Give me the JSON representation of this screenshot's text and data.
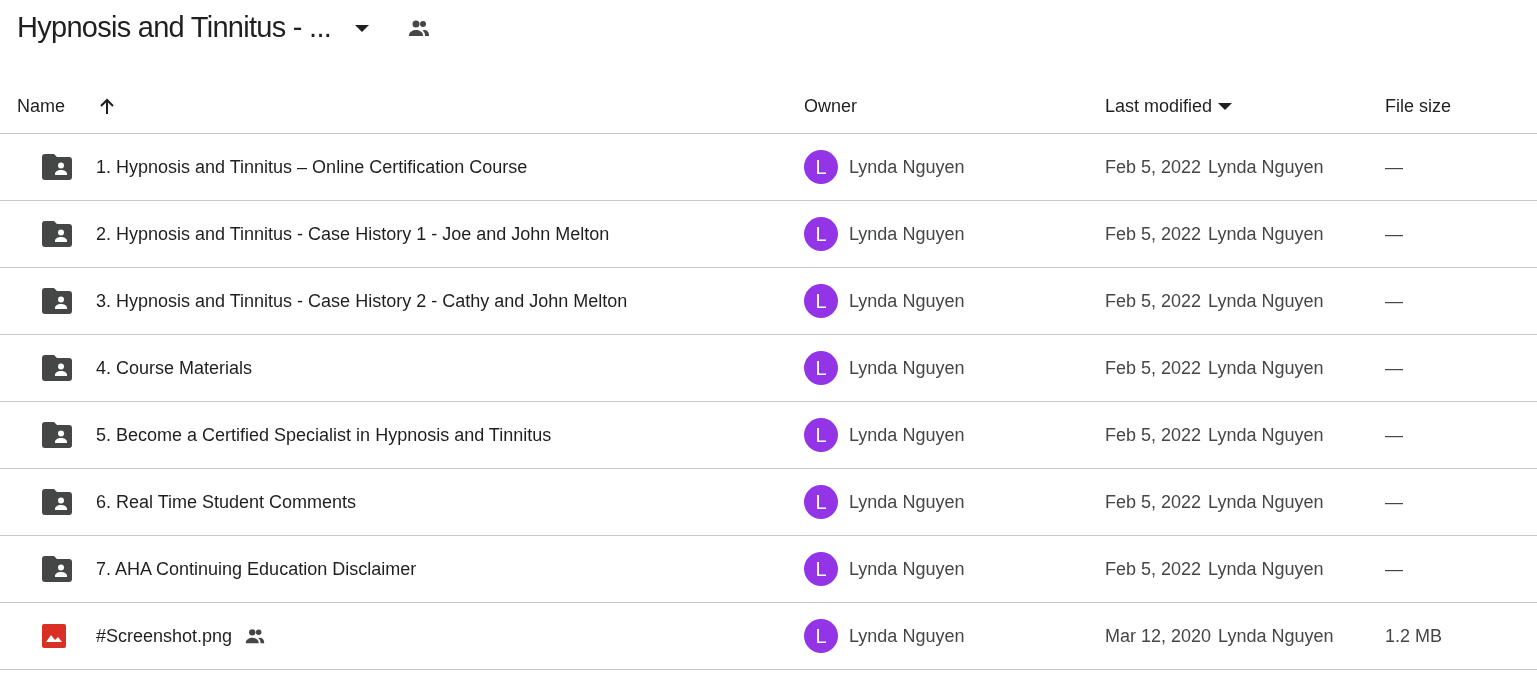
{
  "folder_title": "Hypnosis and Tinnitus - ...",
  "columns": [
    {
      "label": "Name",
      "kind": "sorted-ascending"
    },
    {
      "label": "Owner",
      "kind": "plain"
    },
    {
      "label": "Last modified",
      "kind": "sorted-descending"
    },
    {
      "label": "File size",
      "kind": "plain"
    }
  ],
  "rows": [
    {
      "kind": "shared-folder",
      "name": "1. Hypnosis and Tinnitus – Online Certification Course",
      "shared": false,
      "owner_initial": "L",
      "owner": "Lynda Nguyen",
      "modified_date": "Feb 5, 2022",
      "modified_by": "Lynda Nguyen",
      "size": "—"
    },
    {
      "kind": "shared-folder",
      "name": "2. Hypnosis and Tinnitus - Case History 1 - Joe and John Melton",
      "shared": false,
      "owner_initial": "L",
      "owner": "Lynda Nguyen",
      "modified_date": "Feb 5, 2022",
      "modified_by": "Lynda Nguyen",
      "size": "—"
    },
    {
      "kind": "shared-folder",
      "name": "3. Hypnosis and Tinnitus - Case History 2 - Cathy and John Melton",
      "shared": false,
      "owner_initial": "L",
      "owner": "Lynda Nguyen",
      "modified_date": "Feb 5, 2022",
      "modified_by": "Lynda Nguyen",
      "size": "—"
    },
    {
      "kind": "shared-folder",
      "name": "4. Course Materials",
      "shared": false,
      "owner_initial": "L",
      "owner": "Lynda Nguyen",
      "modified_date": "Feb 5, 2022",
      "modified_by": "Lynda Nguyen",
      "size": "—"
    },
    {
      "kind": "shared-folder",
      "name": "5. Become a Certified Specialist in Hypnosis and Tinnitus",
      "shared": false,
      "owner_initial": "L",
      "owner": "Lynda Nguyen",
      "modified_date": "Feb 5, 2022",
      "modified_by": "Lynda Nguyen",
      "size": "—"
    },
    {
      "kind": "shared-folder",
      "name": "6. Real Time Student Comments",
      "shared": false,
      "owner_initial": "L",
      "owner": "Lynda Nguyen",
      "modified_date": "Feb 5, 2022",
      "modified_by": "Lynda Nguyen",
      "size": "—"
    },
    {
      "kind": "shared-folder",
      "name": "7. AHA Continuing Education Disclaimer",
      "shared": false,
      "owner_initial": "L",
      "owner": "Lynda Nguyen",
      "modified_date": "Feb 5, 2022",
      "modified_by": "Lynda Nguyen",
      "size": "—"
    },
    {
      "kind": "image",
      "name": "#Screenshot.png",
      "shared": true,
      "owner_initial": "L",
      "owner": "Lynda Nguyen",
      "modified_date": "Mar 12, 2020",
      "modified_by": "Lynda Nguyen",
      "size": "1.2 MB"
    }
  ]
}
